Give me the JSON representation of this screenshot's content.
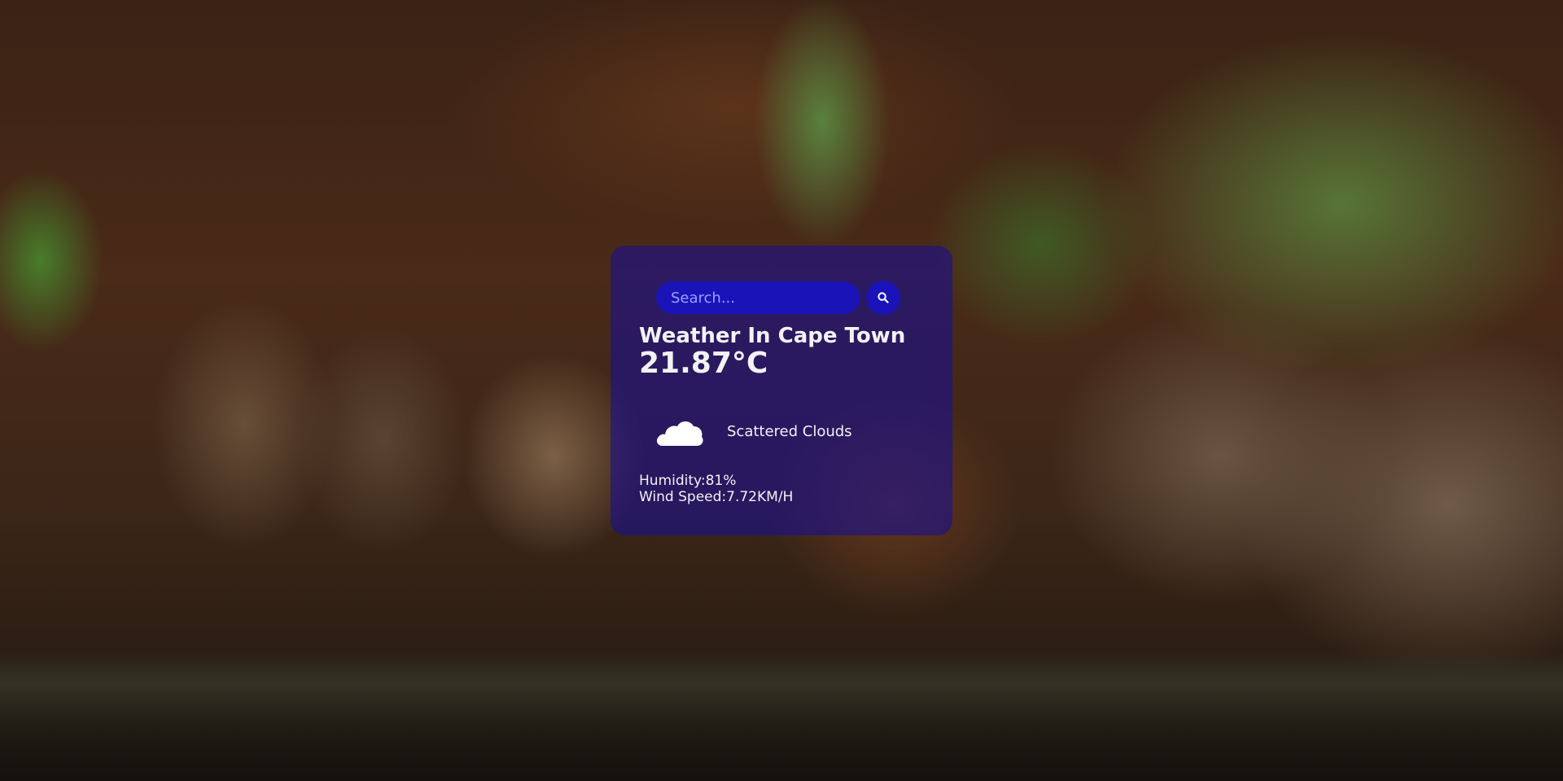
{
  "search": {
    "placeholder": "Search..."
  },
  "weather": {
    "title": "Weather In Cape Town",
    "temperature": "21.87°C",
    "icon": "cloud-icon",
    "description": "Scattered Clouds",
    "humidity": "Humidity:81%",
    "wind_speed": "Wind Speed:7.72KM/H"
  },
  "colors": {
    "card_bg": "#1c108c",
    "input_bg": "#1a14b8",
    "text": "#f2f2f2",
    "placeholder": "#9aa0ff"
  }
}
